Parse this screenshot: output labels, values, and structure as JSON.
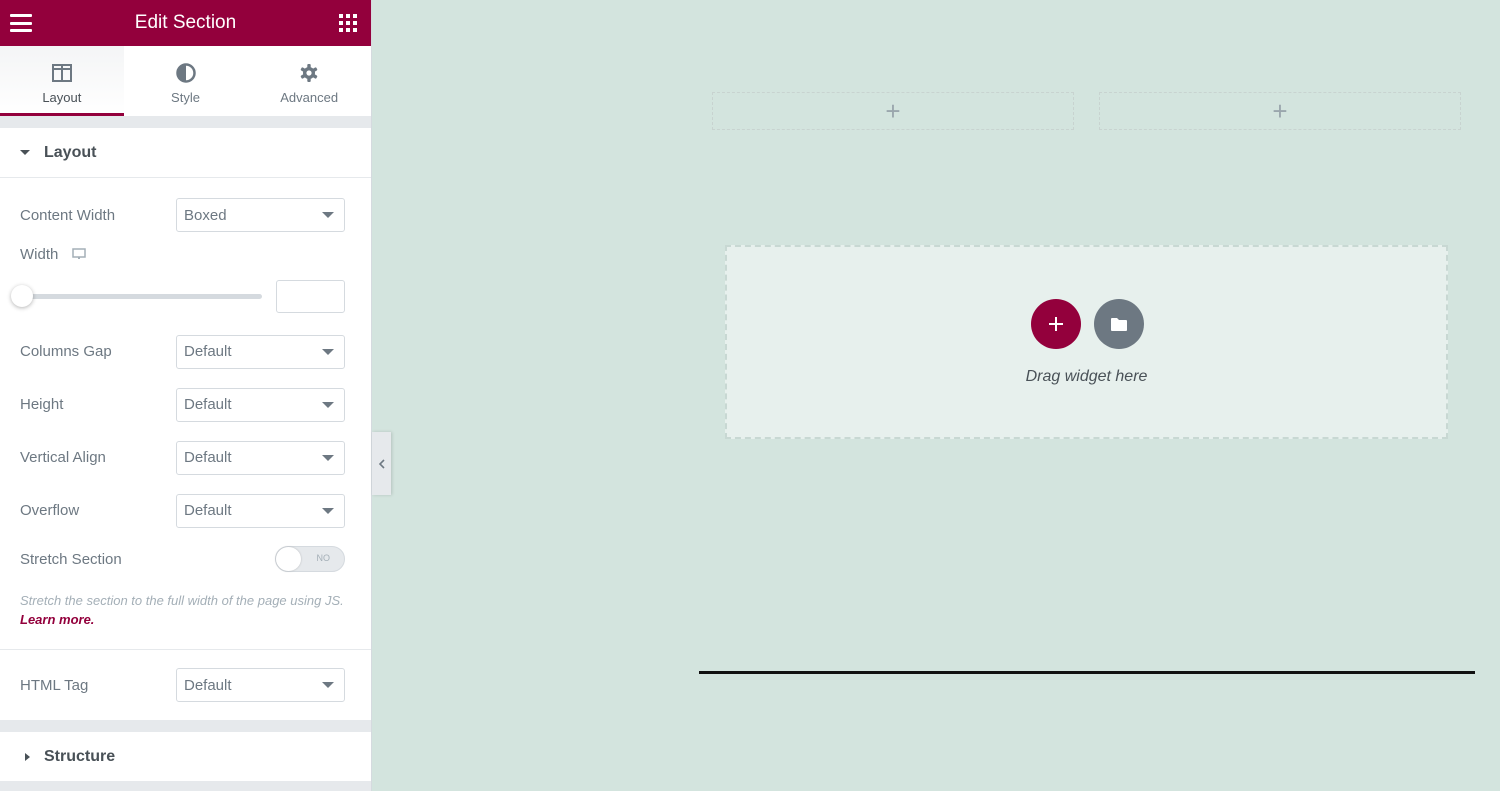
{
  "panel": {
    "title": "Edit Section",
    "menu_icon": "hamburger-icon",
    "apps_icon": "grid-icon",
    "tabs": [
      {
        "label": "Layout",
        "icon": "columns-icon",
        "active": true
      },
      {
        "label": "Style",
        "icon": "half-circle-icon",
        "active": false
      },
      {
        "label": "Advanced",
        "icon": "gear-icon",
        "active": false
      }
    ],
    "layout_section": {
      "title": "Layout",
      "content_width": {
        "label": "Content Width",
        "value": "Boxed"
      },
      "width": {
        "label": "Width",
        "device_icon": "desktop-icon",
        "slider_value_percent": 0,
        "input_value": ""
      },
      "columns_gap": {
        "label": "Columns Gap",
        "value": "Default"
      },
      "height": {
        "label": "Height",
        "value": "Default"
      },
      "vertical_align": {
        "label": "Vertical Align",
        "value": "Default"
      },
      "overflow": {
        "label": "Overflow",
        "value": "Default"
      },
      "stretch_section": {
        "label": "Stretch Section",
        "toggle_text": "NO",
        "enabled": false
      },
      "help_text": "Stretch the section to the full width of the page using JS.",
      "help_link": "Learn more.",
      "html_tag": {
        "label": "HTML Tag",
        "value": "Default"
      }
    },
    "structure_section": {
      "title": "Structure"
    }
  },
  "canvas": {
    "drop_zone_text": "Drag widget here",
    "add_button_icon": "plus-icon",
    "template_button_icon": "folder-icon",
    "column_add_icon": "plus-icon"
  },
  "colors": {
    "brand": "#93003c",
    "canvas_bg": "#d3e4de",
    "text": "#495157"
  }
}
